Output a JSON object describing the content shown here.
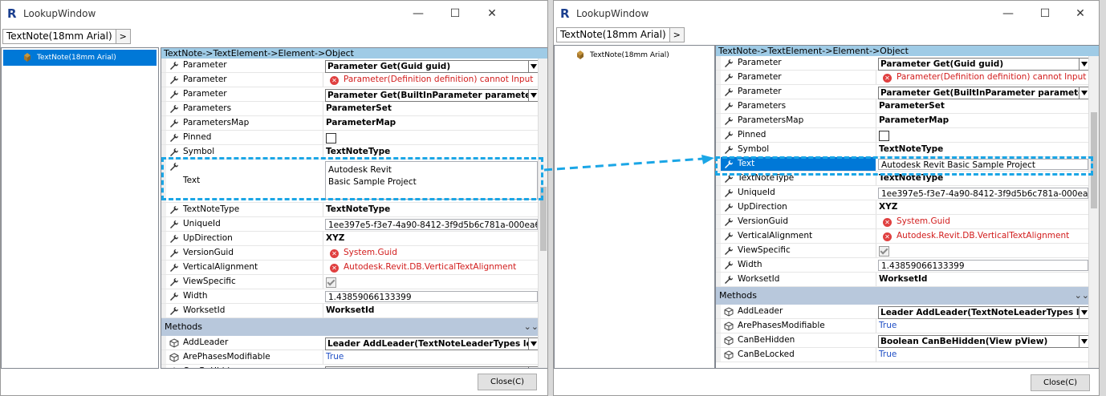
{
  "window": {
    "title": "LookupWindow",
    "minimize_glyph": "—",
    "maximize_glyph": "☐",
    "close_glyph": "✕",
    "close_button_label": "Close(C)"
  },
  "breadcrumb": {
    "item": "TextNote(18mm Arial)",
    "arrow": ">"
  },
  "tree": {
    "selected_item": "TextNote(18mm Arial)"
  },
  "grid": {
    "header": "TextNote->TextElement->Element->Object",
    "methods_label": "Methods",
    "collapse_glyph": "⌄⌄"
  },
  "properties_left": [
    {
      "name": "Parameter",
      "value": "Parameter Get(Guid guid)",
      "kind": "combo"
    },
    {
      "name": "Parameter",
      "value": "Parameter(Definition definition) cannot Input",
      "kind": "error"
    },
    {
      "name": "Parameter",
      "value": "Parameter Get(BuiltInParameter parameterId",
      "kind": "combo"
    },
    {
      "name": "Parameters",
      "value": "ParameterSet",
      "kind": "bold"
    },
    {
      "name": "ParametersMap",
      "value": "ParameterMap",
      "kind": "bold"
    },
    {
      "name": "Pinned",
      "value": "",
      "kind": "checkbox"
    },
    {
      "name": "Symbol",
      "value": "TextNoteType",
      "kind": "bold"
    },
    {
      "name": "Text",
      "value": "Autodesk  Revit\nBasic Sample Project",
      "kind": "multiline"
    },
    {
      "name": "TextNoteType",
      "value": "TextNoteType",
      "kind": "bold"
    },
    {
      "name": "UniqueId",
      "value": "1ee397e5-f3e7-4a90-8412-3f9d5b6c781a-000ea62b",
      "kind": "textbox"
    },
    {
      "name": "UpDirection",
      "value": "XYZ",
      "kind": "bold"
    },
    {
      "name": "VersionGuid",
      "value": "System.Guid",
      "kind": "error"
    },
    {
      "name": "VerticalAlignment",
      "value": "Autodesk.Revit.DB.VerticalTextAlignment",
      "kind": "error"
    },
    {
      "name": "ViewSpecific",
      "value": "",
      "kind": "checked"
    },
    {
      "name": "Width",
      "value": "1.43859066133399",
      "kind": "textbox"
    },
    {
      "name": "WorksetId",
      "value": "WorksetId",
      "kind": "bold"
    }
  ],
  "methods_left": [
    {
      "name": "AddLeader",
      "value": "Leader AddLeader(TextNoteLeaderTypes lea",
      "kind": "combo"
    },
    {
      "name": "ArePhasesModifiable",
      "value": "True",
      "kind": "link"
    },
    {
      "name": "CanBeHidden",
      "value": "Boolean CanBeHidden(View pView)",
      "kind": "combo"
    }
  ],
  "properties_right": [
    {
      "name": "Parameter",
      "value": "Parameter Get(Guid guid)",
      "kind": "combo"
    },
    {
      "name": "Parameter",
      "value": "Parameter(Definition definition) cannot Input",
      "kind": "error"
    },
    {
      "name": "Parameter",
      "value": "Parameter Get(BuiltInParameter parameterId",
      "kind": "combo"
    },
    {
      "name": "Parameters",
      "value": "ParameterSet",
      "kind": "bold"
    },
    {
      "name": "ParametersMap",
      "value": "ParameterMap",
      "kind": "bold"
    },
    {
      "name": "Pinned",
      "value": "",
      "kind": "checkbox"
    },
    {
      "name": "Symbol",
      "value": "TextNoteType",
      "kind": "bold"
    },
    {
      "name": "Text",
      "value": "Autodesk  Revit Basic Sample Project",
      "kind": "textbox-selected"
    },
    {
      "name": "TextNoteType",
      "value": "TextNoteType",
      "kind": "bold"
    },
    {
      "name": "UniqueId",
      "value": "1ee397e5-f3e7-4a90-8412-3f9d5b6c781a-000ea62b",
      "kind": "textbox"
    },
    {
      "name": "UpDirection",
      "value": "XYZ",
      "kind": "bold"
    },
    {
      "name": "VersionGuid",
      "value": "System.Guid",
      "kind": "error"
    },
    {
      "name": "VerticalAlignment",
      "value": "Autodesk.Revit.DB.VerticalTextAlignment",
      "kind": "error"
    },
    {
      "name": "ViewSpecific",
      "value": "",
      "kind": "checked"
    },
    {
      "name": "Width",
      "value": "1.43859066133399",
      "kind": "textbox"
    },
    {
      "name": "WorksetId",
      "value": "WorksetId",
      "kind": "bold"
    }
  ],
  "methods_right": [
    {
      "name": "AddLeader",
      "value": "Leader AddLeader(TextNoteLeaderTypes lea",
      "kind": "combo"
    },
    {
      "name": "ArePhasesModifiable",
      "value": "True",
      "kind": "link"
    },
    {
      "name": "CanBeHidden",
      "value": "Boolean CanBeHidden(View pView)",
      "kind": "combo"
    },
    {
      "name": "CanBeLocked",
      "value": "True",
      "kind": "link"
    }
  ],
  "colors": {
    "selection": "#0078d7",
    "header": "#9fcbe6",
    "error": "#d21c1c",
    "link": "#1f4ec5",
    "callout": "#1ba6e6"
  }
}
